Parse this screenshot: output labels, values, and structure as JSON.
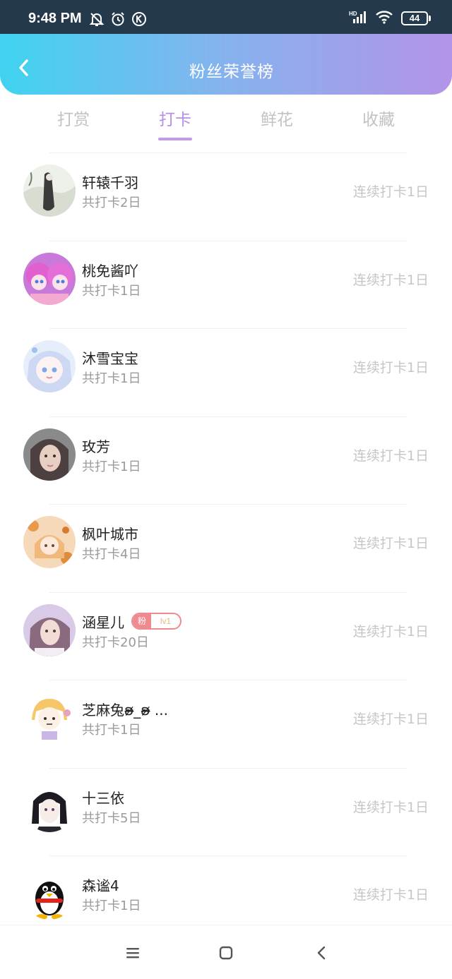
{
  "status": {
    "time": "9:48 PM",
    "battery": "44"
  },
  "header": {
    "title": "粉丝荣誉榜"
  },
  "tabs": [
    {
      "label": "打赏",
      "active": false
    },
    {
      "label": "打卡",
      "active": true
    },
    {
      "label": "鲜花",
      "active": false
    },
    {
      "label": "收藏",
      "active": false
    }
  ],
  "rows": [
    {
      "name": "轩辕千羽",
      "sub": "共打卡2日",
      "streak": "连续打卡1日"
    },
    {
      "name": "桃免酱吖",
      "sub": "共打卡1日",
      "streak": "连续打卡1日"
    },
    {
      "name": "沐雪宝宝",
      "sub": "共打卡1日",
      "streak": "连续打卡1日"
    },
    {
      "name": "玫芳",
      "sub": "共打卡1日",
      "streak": "连续打卡1日"
    },
    {
      "name": "枫叶城市",
      "sub": "共打卡4日",
      "streak": "连续打卡1日"
    },
    {
      "name": "涵星儿",
      "sub": "共打卡20日",
      "streak": "连续打卡1日",
      "badge": {
        "fan": "粉",
        "level": "lv1"
      }
    },
    {
      "name": "芝麻兔ʚ̴̶̷_ʚ̴̶̷ ...",
      "sub": "共打卡1日",
      "streak": "连续打卡1日"
    },
    {
      "name": "十三依",
      "sub": "共打卡5日",
      "streak": "连续打卡1日"
    },
    {
      "name": "森谧4",
      "sub": "共打卡1日",
      "streak": "连续打卡1日"
    }
  ],
  "colors": {
    "accent": "#b98ee3",
    "header_start": "#3fd3f0",
    "header_end": "#b394e8",
    "badge": "#f08a91"
  },
  "icons": [
    "back-chevron-icon",
    "mute-bell-icon",
    "alarm-icon",
    "k-icon",
    "signal-icon",
    "wifi-icon",
    "menu-icon",
    "home-square-icon",
    "back-triangle-icon"
  ]
}
